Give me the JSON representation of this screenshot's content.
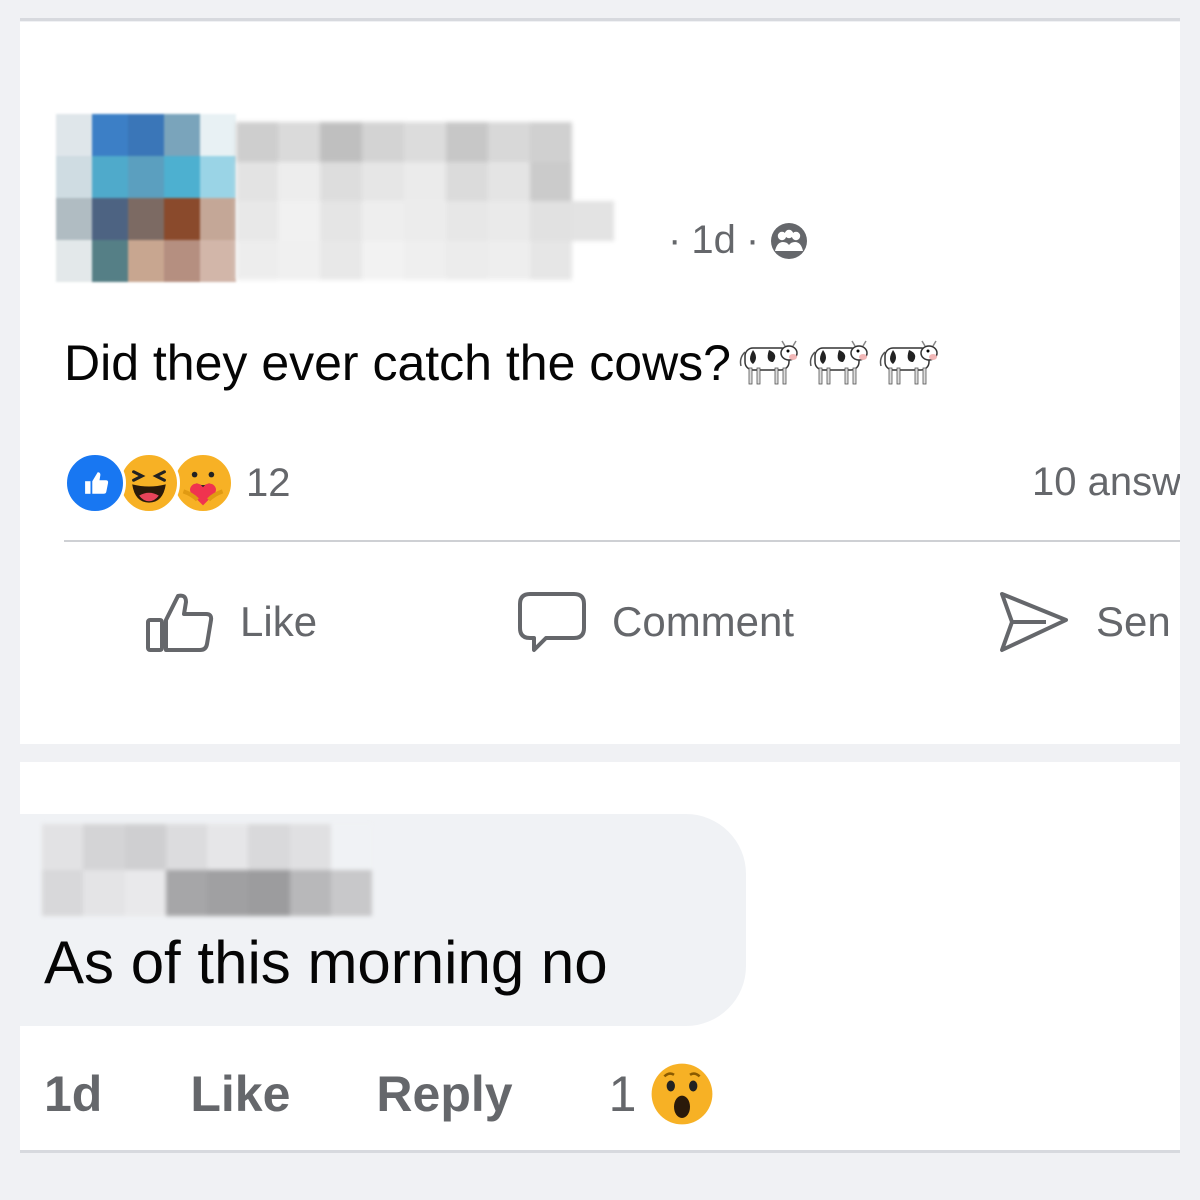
{
  "post": {
    "time": "1d",
    "separator": "·",
    "audience_icon": "friends-icon",
    "text": "Did they ever catch the cows?",
    "emoji": [
      "cow-icon",
      "cow-icon",
      "cow-icon"
    ],
    "reactions": {
      "icons": [
        "like-reaction-icon",
        "haha-reaction-icon",
        "care-reaction-icon"
      ],
      "count": "12"
    },
    "answers": "10 answ",
    "actions": {
      "like_label": "Like",
      "comment_label": "Comment",
      "send_label": "Sen"
    }
  },
  "comment": {
    "text": "As of this morning no",
    "time": "1d",
    "like_label": "Like",
    "reply_label": "Reply",
    "reaction_count": "1",
    "reaction_icon": "wow-reaction-icon"
  },
  "colors": {
    "secondary_text": "#65676b",
    "like_blue": "#1877f2",
    "emoji_yellow": "#f7b125",
    "bubble_bg": "#f0f2f5",
    "page_bg": "#f0f1f4"
  }
}
